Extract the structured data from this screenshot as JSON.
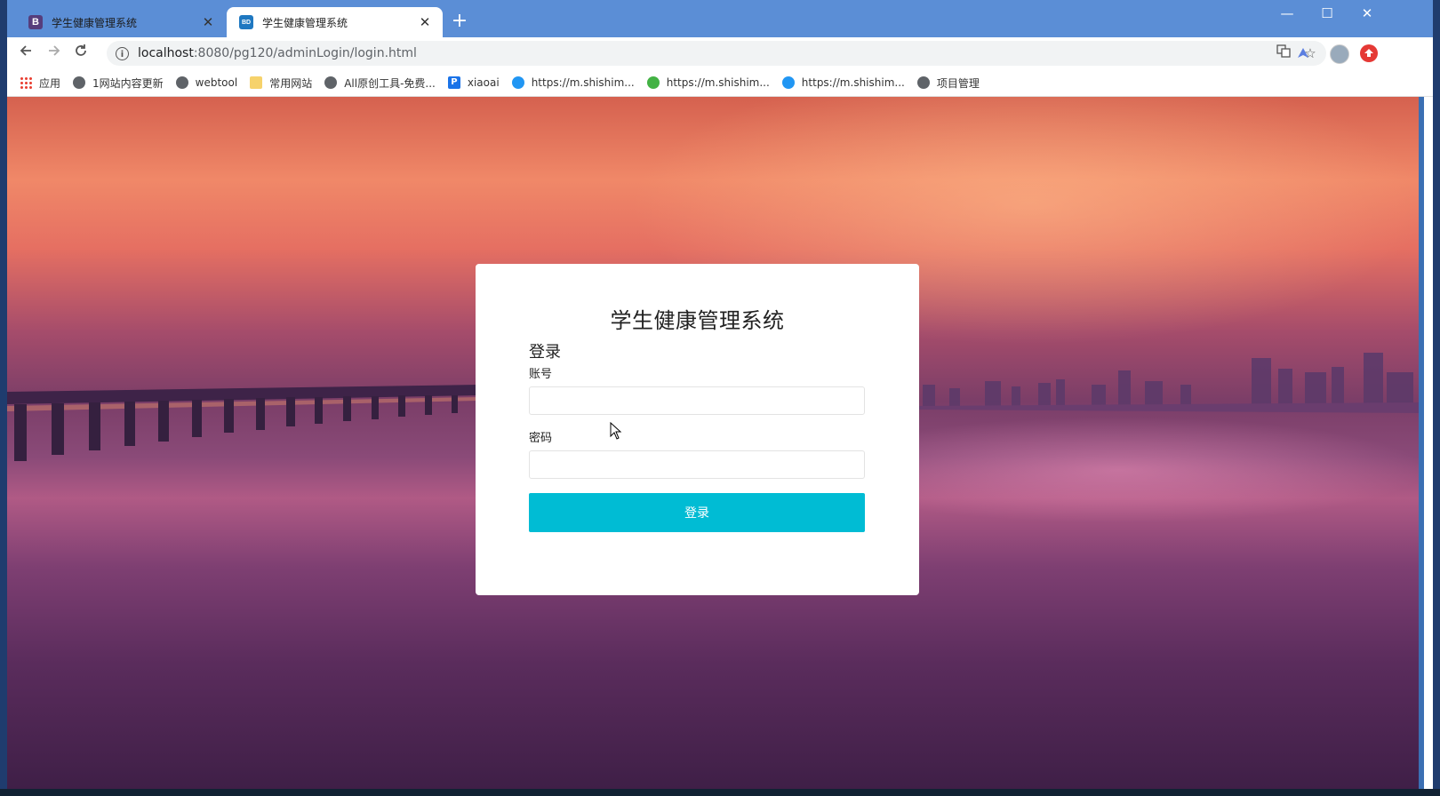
{
  "browser": {
    "tabs": [
      {
        "title": "学生健康管理系统",
        "favicon": "B",
        "close": "✕"
      },
      {
        "title": "学生健康管理系统",
        "favicon": "BD",
        "close": "✕"
      }
    ],
    "new_tab": "+",
    "window_controls": {
      "minimize": "—",
      "maximize": "☐",
      "close": "✕"
    },
    "url": {
      "host": "localhost",
      "rest": ":8080/pg120/adminLogin/login.html"
    },
    "bookmarks": [
      {
        "label": "应用",
        "icon": "apps-icon"
      },
      {
        "label": "1网站内容更新",
        "icon": "globe-icon"
      },
      {
        "label": "webtool",
        "icon": "globe-icon"
      },
      {
        "label": "常用网站",
        "icon": "folder-icon"
      },
      {
        "label": "All原创工具-免费...",
        "icon": "globe-icon"
      },
      {
        "label": "xiaoai",
        "icon": "p-icon"
      },
      {
        "label": "https://m.shishim...",
        "icon": "c-icon"
      },
      {
        "label": "https://m.shishim...",
        "icon": "wechat-icon"
      },
      {
        "label": "https://m.shishim...",
        "icon": "c-icon"
      },
      {
        "label": "项目管理",
        "icon": "globe-icon"
      }
    ]
  },
  "login": {
    "title": "学生健康管理系统",
    "heading": "登录",
    "account_label": "账号",
    "account_value": "",
    "password_label": "密码",
    "password_value": "",
    "submit_label": "登录"
  },
  "colors": {
    "accent": "#00bcd4",
    "titlebar": "#5b8ed6"
  }
}
